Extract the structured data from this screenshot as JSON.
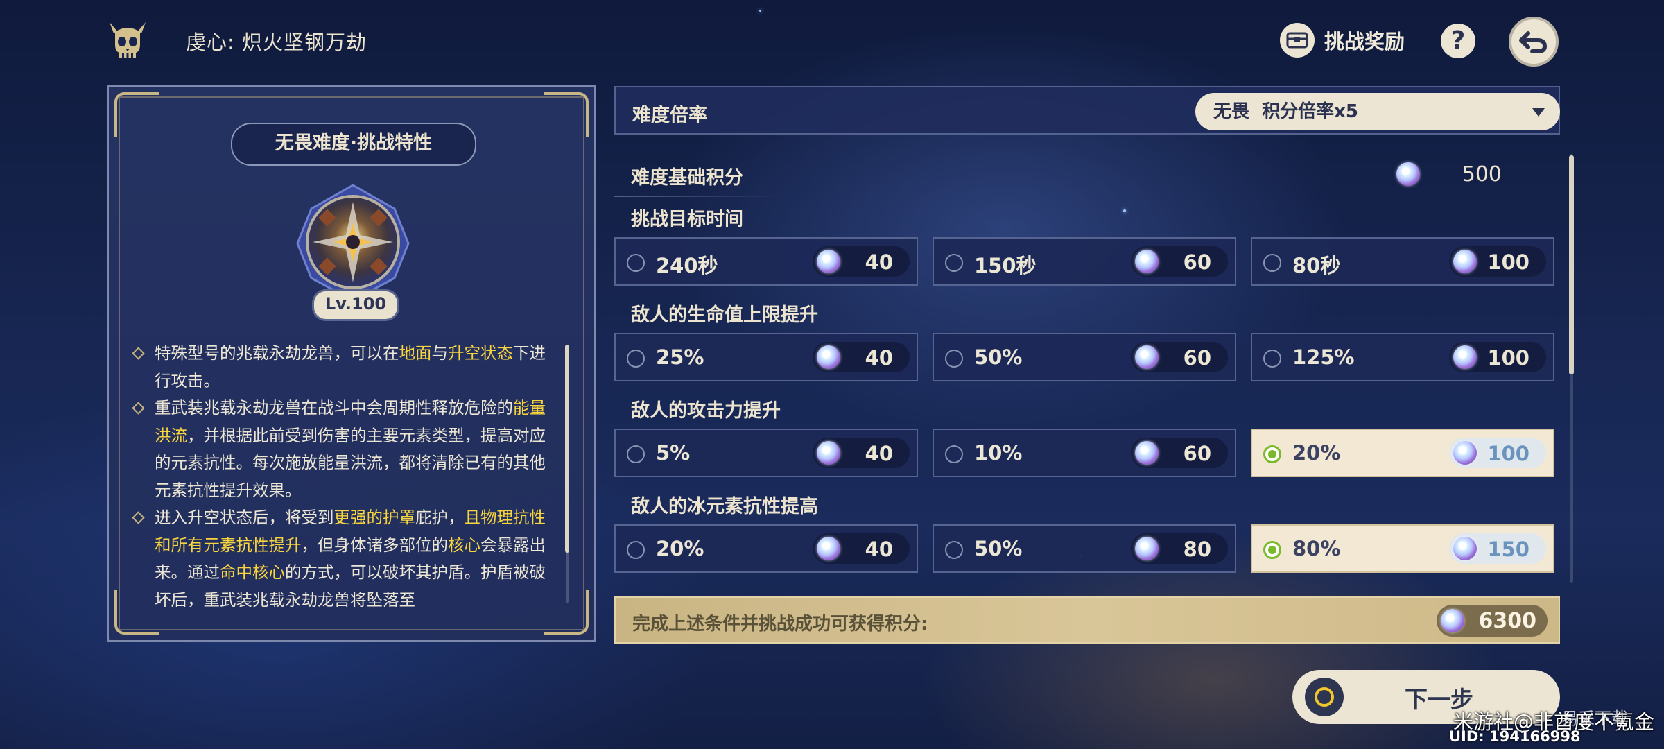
{
  "header": {
    "title": "虔心: 炽火坚钢万劫",
    "reward_label": "挑战奖励",
    "help_symbol": "?"
  },
  "left_panel": {
    "title": "无畏难度·挑战特性",
    "level": "Lv.100",
    "description": [
      {
        "segments": [
          {
            "text": "特殊型号的兆载永劫龙兽，可以在",
            "hl": false
          },
          {
            "text": "地面",
            "hl": true
          },
          {
            "text": "与",
            "hl": false
          },
          {
            "text": "升空状态",
            "hl": true
          },
          {
            "text": "下进行攻击。",
            "hl": false
          }
        ]
      },
      {
        "segments": [
          {
            "text": "重武装兆载永劫龙兽在战斗中会周期性释放危险的",
            "hl": false
          },
          {
            "text": "能量洪流",
            "hl": true
          },
          {
            "text": "，并根据此前受到伤害的主要元素类型，提高对应的元素抗性。每次施放能量洪流，都将清除已有的其他元素抗性提升效果。",
            "hl": false
          }
        ]
      },
      {
        "segments": [
          {
            "text": "进入升空状态后，将受到",
            "hl": false
          },
          {
            "text": "更强的护罩",
            "hl": true
          },
          {
            "text": "庇护，",
            "hl": false
          },
          {
            "text": "且物理抗性和所有元素抗性提升",
            "hl": true
          },
          {
            "text": "，但身体诸多部位的",
            "hl": false
          },
          {
            "text": "核心",
            "hl": true
          },
          {
            "text": "会暴露出来。通过",
            "hl": false
          },
          {
            "text": "命中核心",
            "hl": true
          },
          {
            "text": "的方式，可以破坏其护盾。护盾被破坏后，重武装兆载永劫龙兽将坠落至",
            "hl": false
          }
        ]
      }
    ]
  },
  "difficulty": {
    "label": "难度倍率",
    "selected": "无畏  积分倍率x5"
  },
  "base_score": {
    "label": "难度基础积分",
    "value": "500"
  },
  "sections": [
    {
      "label": "挑战目标时间",
      "options": [
        {
          "label": "240秒",
          "points": "40",
          "selected": false
        },
        {
          "label": "150秒",
          "points": "60",
          "selected": false
        },
        {
          "label": "80秒",
          "points": "100",
          "selected": false
        }
      ]
    },
    {
      "label": "敌人的生命值上限提升",
      "options": [
        {
          "label": "25%",
          "points": "40",
          "selected": false
        },
        {
          "label": "50%",
          "points": "60",
          "selected": false
        },
        {
          "label": "125%",
          "points": "100",
          "selected": false
        }
      ]
    },
    {
      "label": "敌人的攻击力提升",
      "options": [
        {
          "label": "5%",
          "points": "40",
          "selected": false
        },
        {
          "label": "10%",
          "points": "60",
          "selected": false
        },
        {
          "label": "20%",
          "points": "100",
          "selected": true
        }
      ]
    },
    {
      "label": "敌人的冰元素抗性提高",
      "options": [
        {
          "label": "20%",
          "points": "40",
          "selected": false
        },
        {
          "label": "50%",
          "points": "80",
          "selected": false
        },
        {
          "label": "80%",
          "points": "150",
          "selected": true
        }
      ]
    }
  ],
  "total": {
    "label": "完成上述条件并挑战成功可获得积分:",
    "value": "6300"
  },
  "next_button": {
    "label": "下一步"
  },
  "watermark": {
    "line1": "米游社@非酋度不氪金",
    "uid": "UID: 194166998",
    "logo_text": "易采下载"
  },
  "colors": {
    "highlight": "#f8d43e",
    "selected_radio": "#7ab928",
    "cream": "#ece5d3"
  }
}
